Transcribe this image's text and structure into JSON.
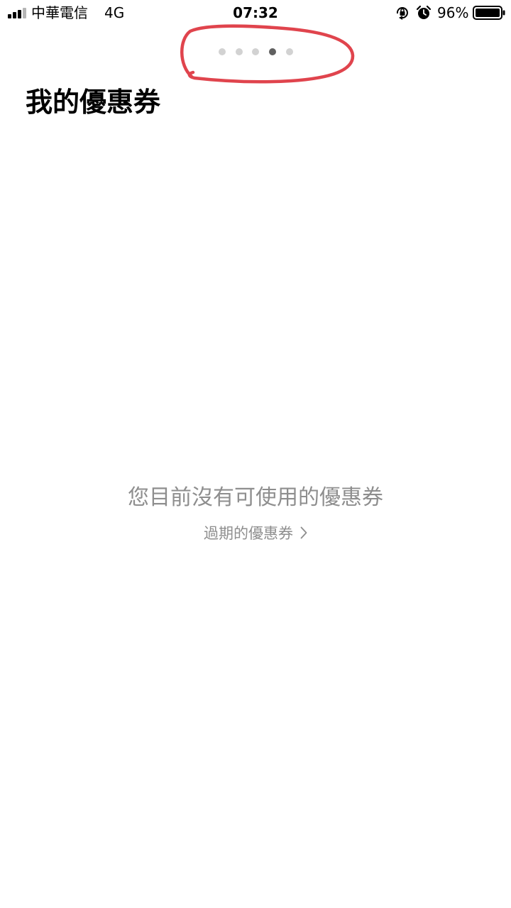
{
  "status_bar": {
    "carrier": "中華電信",
    "network": "4G",
    "time": "07:32",
    "battery": "96%",
    "icons": [
      "signal-icon",
      "orientation-lock-icon",
      "alarm-icon",
      "battery-icon"
    ]
  },
  "page_indicator": {
    "count": 5,
    "active_index": 3
  },
  "annotation": {
    "color": "#e0444d",
    "shape": "hand-drawn-circle"
  },
  "page": {
    "title": "我的優惠券",
    "empty_message": "您目前沒有可使用的優惠券",
    "expired_link": "過期的優惠券"
  },
  "colors": {
    "background": "#ffffff",
    "text_primary": "#000000",
    "text_muted": "#8e8e8e",
    "dot_inactive": "#d2d2d2",
    "dot_active": "#606060"
  }
}
